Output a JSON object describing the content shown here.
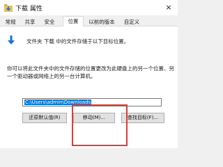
{
  "window": {
    "title": "下载 属性",
    "close_glyph": "×"
  },
  "tabs": [
    {
      "label": "常规"
    },
    {
      "label": "共享"
    },
    {
      "label": "安全"
    },
    {
      "label": "位置",
      "active": true
    },
    {
      "label": "以前的版本"
    },
    {
      "label": "自定义"
    }
  ],
  "location": {
    "info_text": "文件夹 下载 中的文件存储于以下目标位置。",
    "description": "你可以将此文件夹中的文件存储的位置更改为此硬盘上的另一个位置、另一个驱动器或网络上的另一台计算机。",
    "path": "C:\\Users\\admin\\Downloads"
  },
  "buttons": {
    "restore_default": "还原默认值(R)",
    "move": "移动(M)...",
    "find_target": "查找目标(F)..."
  },
  "colors": {
    "accent": "#0078d7",
    "highlight": "#e53935"
  },
  "icons": {
    "title": "folder-download-icon",
    "info": "arrow-down-icon"
  }
}
